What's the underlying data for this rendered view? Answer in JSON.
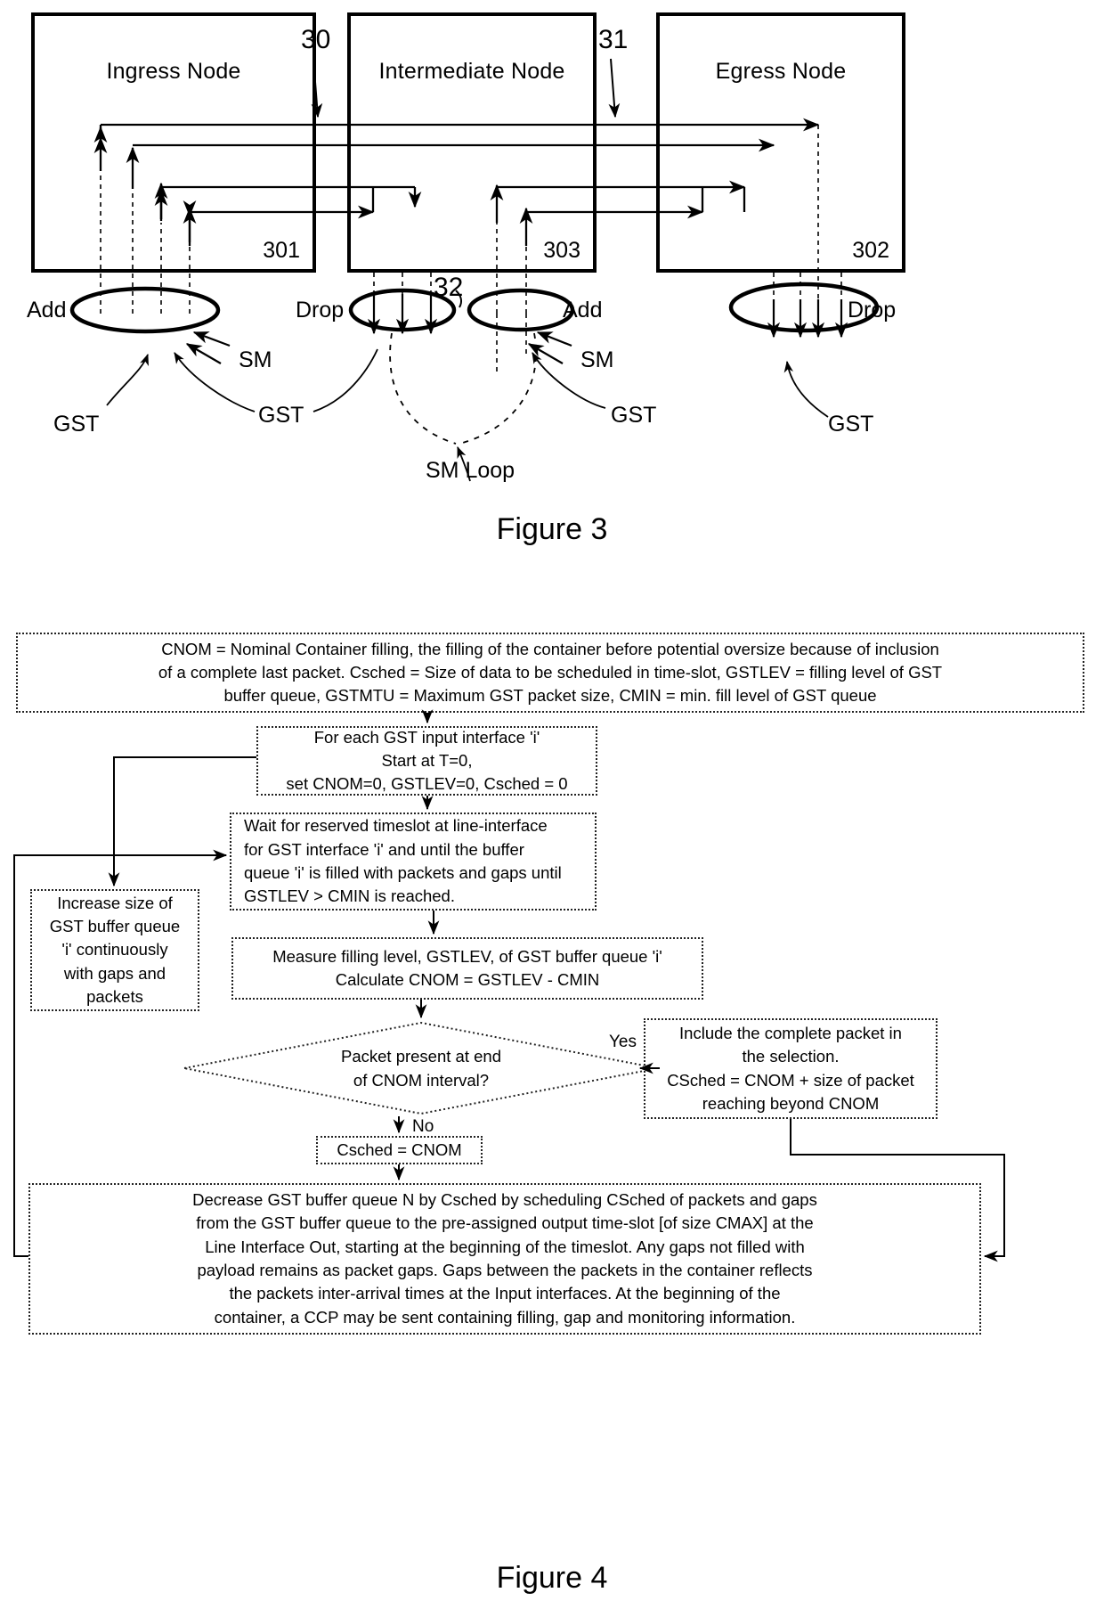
{
  "figure3": {
    "caption": "Figure 3",
    "nodes": [
      {
        "title": "Ingress Node",
        "ref": "301"
      },
      {
        "title": "Intermediate Node",
        "ref": "303"
      },
      {
        "title": "Egress Node",
        "ref": "302"
      }
    ],
    "ref_labels": [
      {
        "id": "link-30",
        "text": "30"
      },
      {
        "id": "link-31",
        "text": "31"
      },
      {
        "id": "loop-32",
        "text": "32"
      }
    ],
    "port_labels": [
      {
        "id": "add-ingress",
        "text": "Add"
      },
      {
        "id": "drop-intermediate",
        "text": "Drop"
      },
      {
        "id": "add-intermediate",
        "text": "Add"
      },
      {
        "id": "drop-egress",
        "text": "Drop"
      }
    ],
    "signal_labels": [
      {
        "id": "sm-ingress",
        "text": "SM"
      },
      {
        "id": "sm-intermediate",
        "text": "SM"
      },
      {
        "id": "gst-ingress-1",
        "text": "GST"
      },
      {
        "id": "gst-ingress-2",
        "text": "GST"
      },
      {
        "id": "gst-intermediate",
        "text": "GST"
      },
      {
        "id": "gst-egress",
        "text": "GST"
      },
      {
        "id": "sm-loop",
        "text": "SM Loop"
      }
    ]
  },
  "figure4": {
    "caption": "Figure 4",
    "definitions_box": {
      "lines": [
        "CNOM = Nominal Container filling, the filling of the container before potential oversize because of inclusion",
        "of a complete last packet. Csched = Size of data to be scheduled in time-slot, GSTLEV = filling level of GST",
        "buffer queue, GSTMTU = Maximum GST packet size, CMIN = min. fill level of GST queue"
      ]
    },
    "start_box": {
      "lines": [
        "For each GST input interface 'i'",
        "Start at T=0,",
        "set CNOM=0, GSTLEV=0, Csched = 0"
      ]
    },
    "wait_box": {
      "lines": [
        "Wait for reserved timeslot at line-interface",
        "for GST interface 'i' and until the buffer",
        "queue 'i' is filled with packets and gaps until",
        "GSTLEV > CMIN is reached."
      ]
    },
    "increase_box": {
      "lines": [
        "Increase size of",
        "GST buffer queue",
        "'i' continuously",
        "with gaps and",
        "packets"
      ]
    },
    "measure_box": {
      "lines": [
        "Measure filling level, GSTLEV, of GST buffer queue 'i'",
        "Calculate CNOM = GSTLEV - CMIN"
      ]
    },
    "decision": {
      "lines": [
        "Packet present at end",
        "of CNOM interval?"
      ],
      "yes_label": "Yes",
      "no_label": "No"
    },
    "include_box": {
      "lines": [
        "Include the complete packet in",
        "the selection.",
        "CSched = CNOM + size of packet",
        "reaching beyond CNOM"
      ]
    },
    "csched_box": {
      "lines": [
        "Csched = CNOM"
      ]
    },
    "decrease_box": {
      "lines": [
        "Decrease GST buffer queue N by Csched by scheduling CSched of packets and gaps",
        "from the GST buffer queue to the pre-assigned output time-slot [of size CMAX] at the",
        "Line Interface Out, starting at the beginning of the timeslot. Any gaps not filled with",
        "payload remains as packet gaps. Gaps between the packets in the container reflects",
        "the packets inter-arrival times at the Input interfaces. At the beginning of the",
        "container, a CCP may be sent containing filling, gap  and monitoring information."
      ]
    }
  }
}
